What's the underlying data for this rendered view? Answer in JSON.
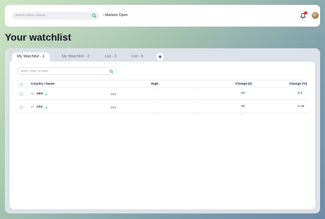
{
  "header": {
    "search_placeholder": "Search indices, shares...",
    "market_status": "Markets Open",
    "notification_badge": "",
    "icons": {
      "search": "search-icon",
      "bell": "bell-icon",
      "avatar": "avatar"
    }
  },
  "page": {
    "title": "Your watchlist"
  },
  "tabs": [
    {
      "label": "My Watchlist - 1",
      "active": true
    },
    {
      "label": "My Watchlist - 2",
      "active": false
    },
    {
      "label": "List - 3",
      "active": false
    },
    {
      "label": "List - 4",
      "active": false
    }
  ],
  "add_tab_label": "+",
  "filter": {
    "placeholder": "EUR / USD or AAPL"
  },
  "table": {
    "columns": [
      "Country / Name",
      "High",
      "Change (€)",
      "Change (%)"
    ],
    "rows": [
      {
        "country_code": "NL",
        "name": "AEX",
        "trend": "▲",
        "value": "XXX",
        "high": "'",
        "mid": "'",
        "change_abs": "-10",
        "change_pct": "-5.1"
      },
      {
        "country_code": "AT",
        "name": "ATX",
        "trend": "▲",
        "value": "XXX",
        "high": "'",
        "mid": "'",
        "change_abs": "-42",
        "change_pct": "-1.34"
      }
    ],
    "third_row": {
      "high": "'",
      "mid": "'",
      "change_abs": "'"
    }
  },
  "colors": {
    "positive": "#27a55a",
    "alert": "#e53935"
  }
}
